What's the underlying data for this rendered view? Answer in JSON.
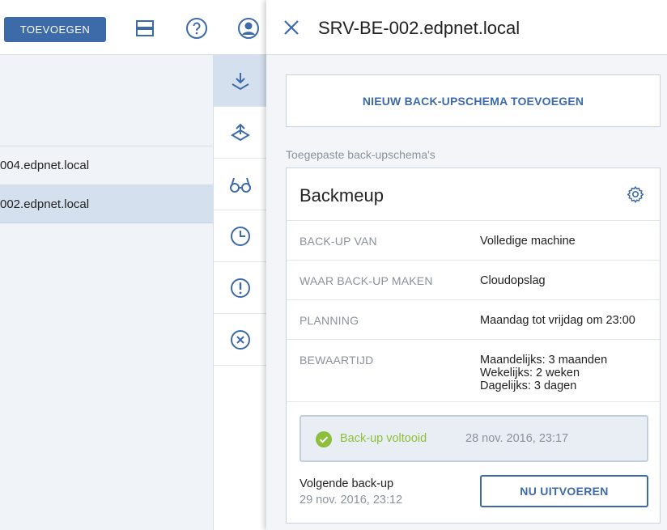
{
  "topbar": {
    "add_button": "TOEVOEGEN",
    "icons": [
      "layout-icon",
      "help-icon",
      "account-icon"
    ]
  },
  "list": {
    "rows": [
      {
        "label": "004.edpnet.local",
        "selected": false
      },
      {
        "label": "002.edpnet.local",
        "selected": true
      }
    ]
  },
  "iconbar": {
    "items": [
      "backup-icon",
      "recovery-icon",
      "vulnerability-icon",
      "activities-icon",
      "alerts-icon",
      "delete-icon"
    ],
    "active_index": 0
  },
  "panel": {
    "title": "SRV-BE-002.edpnet.local",
    "new_plan_button": "NIEUW BACK-UPSCHEMA TOEVOEGEN",
    "applied_label": "Toegepaste back-upschema's",
    "plan": {
      "name": "Backmeup",
      "rows": [
        {
          "key": "BACK-UP VAN",
          "value": "Volledige machine"
        },
        {
          "key": "WAAR BACK-UP MAKEN",
          "value": "Cloudopslag"
        },
        {
          "key": "PLANNING",
          "value": "Maandag tot vrijdag om 23:00"
        },
        {
          "key": "BEWAARTIJD",
          "value_lines": [
            "Maandelijks: 3 maanden",
            "Wekelijks: 2 weken",
            "Dagelijks: 3 dagen"
          ]
        }
      ],
      "status": {
        "text": "Back-up voltooid",
        "time": "28 nov. 2016, 23:17"
      },
      "next_backup": {
        "label": "Volgende back-up",
        "time": "29 nov. 2016, 23:12"
      },
      "run_button": "NU UITVOEREN"
    }
  },
  "colors": {
    "accent": "#3d6aa8",
    "success": "#8dbf3c",
    "muted": "#8a929c"
  }
}
